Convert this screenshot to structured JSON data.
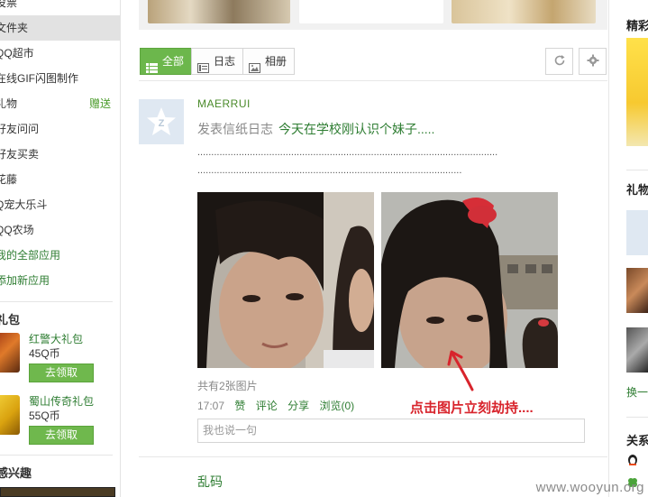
{
  "sidebar": {
    "items": [
      {
        "label": "役票"
      },
      {
        "label": "文件夹"
      },
      {
        "label": "QQ超市"
      },
      {
        "label": "在线GIF闪图制作"
      },
      {
        "label": "礼物",
        "extra": "赠送"
      },
      {
        "label": "好友问问"
      },
      {
        "label": "好友买卖"
      },
      {
        "label": "花藤"
      },
      {
        "label": "Q宠大乐斗"
      },
      {
        "label": "QQ农场"
      },
      {
        "label": "我的全部应用"
      },
      {
        "label": "添加新应用"
      }
    ],
    "gift_heading": "礼包",
    "gifts": [
      {
        "title": "红警大礼包",
        "price": "45Q币",
        "button": "去领取"
      },
      {
        "title": "蜀山传奇礼包",
        "price": "55Q币",
        "button": "去领取"
      }
    ],
    "interest_heading": "感兴趣"
  },
  "toolbar": {
    "tabs": [
      {
        "label": "全部",
        "icon": "list-icon"
      },
      {
        "label": "日志",
        "icon": "diary-icon"
      },
      {
        "label": "相册",
        "icon": "photo-icon"
      }
    ],
    "refresh_icon": "refresh-icon",
    "settings_icon": "gear-icon"
  },
  "feed": {
    "post1": {
      "author": "MAERRUI",
      "action": "发表信纸日志",
      "title_link": "今天在学校刚认识个妹子.....",
      "dots_line1": ".............................................................................................................",
      "dots_line2": "................................................................................................",
      "photo_count": "共有2张图片",
      "time": "17:07",
      "like": "赞",
      "comment": "评论",
      "share": "分享",
      "views": "浏览(0)",
      "comment_placeholder": "我也说一句"
    },
    "post2": {
      "author": "乱码"
    },
    "annotation": "点击图片立刻劫持...."
  },
  "right": {
    "heading1": "精彩",
    "heading2": "礼物",
    "link": "换一",
    "heading3": "关系"
  },
  "watermark": "www.wooyun.org",
  "colors": {
    "accent_green": "#6cb74c",
    "link_green": "#2e7d32",
    "annotation_red": "#d8242c"
  }
}
